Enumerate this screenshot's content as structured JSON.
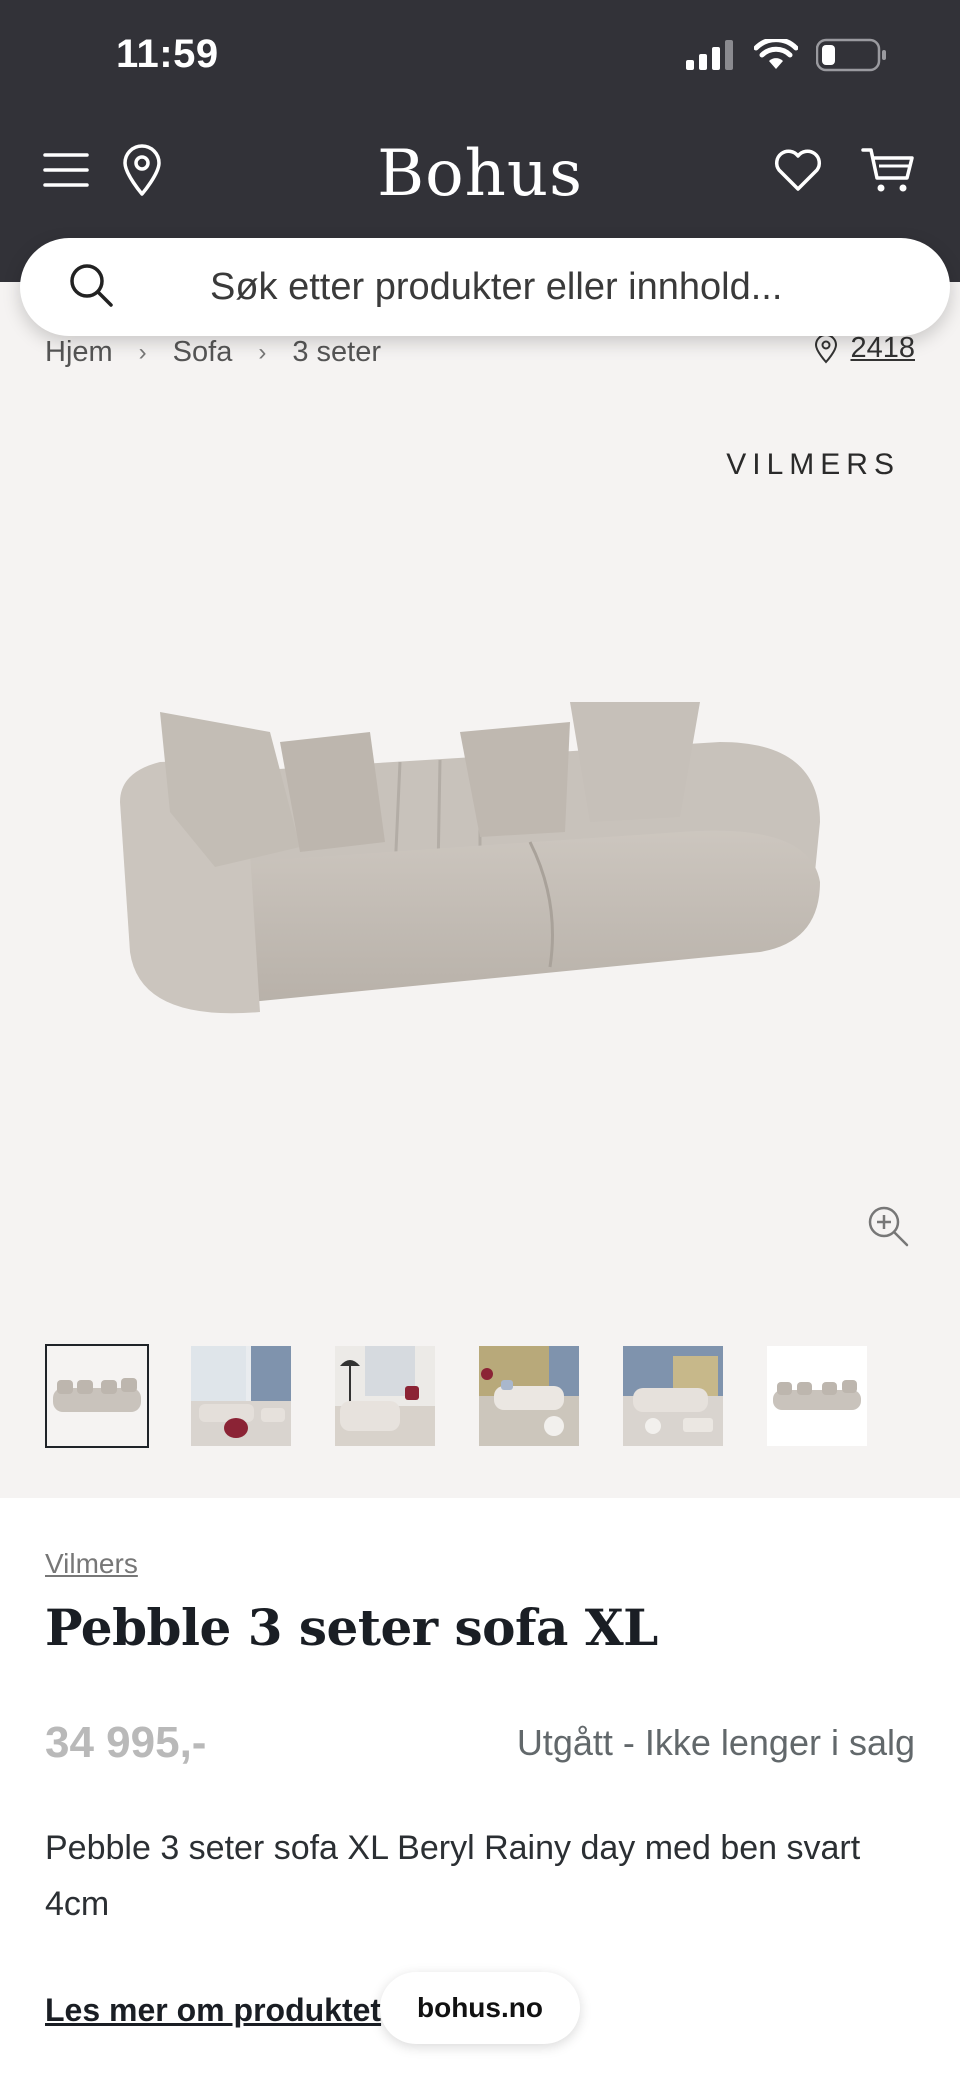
{
  "status_bar": {
    "time": "11:59"
  },
  "header": {
    "logo": "Bohus",
    "menu_icon": "hamburger-icon",
    "location_icon": "location-pin-icon",
    "wishlist_icon": "heart-icon",
    "cart_icon": "cart-icon"
  },
  "search": {
    "placeholder": "Søk etter produkter eller innhold..."
  },
  "breadcrumb": {
    "items": [
      "Hjem",
      "Sofa",
      "3 seter"
    ],
    "store_number": "2418"
  },
  "gallery": {
    "brand_mark": "VILMERS",
    "thumbnail_count": 6,
    "active_thumbnail": 1
  },
  "product": {
    "brand": "Vilmers",
    "title": "Pebble 3 seter sofa XL",
    "price": "34 995,-",
    "availability": "Utgått - Ikke lenger i salg",
    "description": "Pebble 3 seter sofa XL Beryl Rainy day med ben svart 4cm",
    "read_more": "Les mer om produktet"
  },
  "browser": {
    "url_pill": "bohus.no"
  },
  "colors": {
    "header_bg": "#323238",
    "gallery_bg": "#f5f3f2",
    "sofa": "#c9c3bc",
    "price_muted": "#b9b9b9",
    "status_text": "#62686b"
  }
}
